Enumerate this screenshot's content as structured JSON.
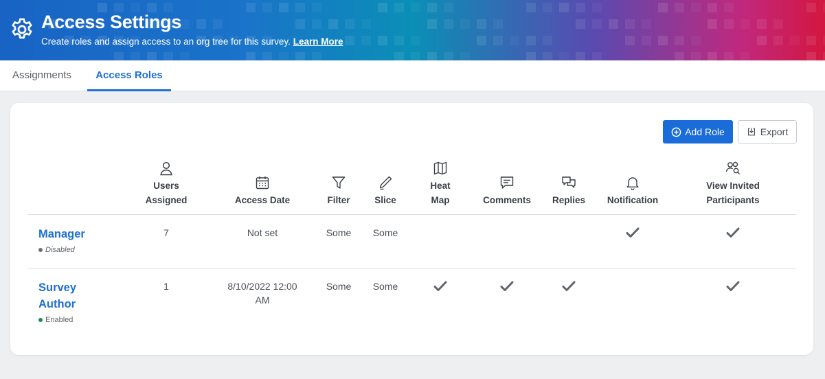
{
  "header": {
    "title": "Access Settings",
    "subtitle": "Create roles and assign access to an org tree for this survey.",
    "learn_more": "Learn More",
    "icon": "gear-icon"
  },
  "tabs": [
    {
      "label": "Assignments",
      "active": false
    },
    {
      "label": "Access Roles",
      "active": true
    }
  ],
  "toolbar": {
    "add_role_label": "Add Role",
    "export_label": "Export"
  },
  "columns": {
    "users_assigned": {
      "line1": "Users",
      "line2": "Assigned",
      "icon": "user-icon"
    },
    "access_date": {
      "label": "Access Date",
      "icon": "calendar-icon"
    },
    "filter": {
      "label": "Filter",
      "icon": "filter-icon"
    },
    "slice": {
      "label": "Slice",
      "icon": "pen-icon"
    },
    "heat_map": {
      "line1": "Heat",
      "line2": "Map",
      "icon": "map-icon"
    },
    "comments": {
      "label": "Comments",
      "icon": "comment-icon"
    },
    "replies": {
      "label": "Replies",
      "icon": "replies-icon"
    },
    "notification": {
      "label": "Notification",
      "icon": "bell-icon"
    },
    "view_invited": {
      "line1": "View Invited",
      "line2": "Participants",
      "icon": "participants-icon"
    }
  },
  "roles": [
    {
      "name": "Manager",
      "status": "Disabled",
      "users_assigned": "7",
      "access_date": "Not set",
      "filter": "Some",
      "slice": "Some",
      "heat_map": false,
      "comments": false,
      "replies": false,
      "notification": true,
      "view_invited": true
    },
    {
      "name_line1": "Survey",
      "name_line2": "Author",
      "status": "Enabled",
      "users_assigned": "1",
      "access_date_line1": "8/10/2022 12:00",
      "access_date_line2": "AM",
      "filter": "Some",
      "slice": "Some",
      "heat_map": true,
      "comments": true,
      "replies": true,
      "notification": false,
      "view_invited": true
    }
  ],
  "colors": {
    "accent": "#1f6fd1",
    "primary_button": "#1a6cd8",
    "enabled": "#1c8a54",
    "disabled": "#6b7078"
  }
}
